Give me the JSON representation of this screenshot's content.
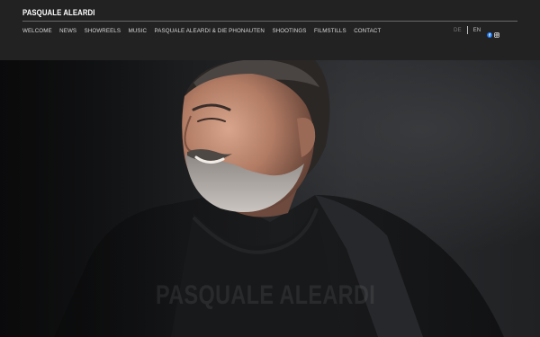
{
  "site": {
    "title": "PASQUALE ALEARDI"
  },
  "nav": {
    "items": [
      {
        "label": "WELCOME"
      },
      {
        "label": "NEWS"
      },
      {
        "label": "SHOWREELS"
      },
      {
        "label": "MUSIC"
      },
      {
        "label": "PASQUALE ALEARDI & DIE PHONAUTEN"
      },
      {
        "label": "SHOOTINGS"
      },
      {
        "label": "FILMSTILLS"
      },
      {
        "label": "CONTACT"
      }
    ]
  },
  "language": {
    "de": "DE",
    "en": "EN"
  },
  "social": {
    "icons": [
      "facebook-icon",
      "instagram-icon"
    ]
  },
  "hero": {
    "watermark": "PASQUALE ALEARDI"
  },
  "colors": {
    "header_bg": "#222222",
    "page_bg": "#141414",
    "facebook_blue": "#1877f2"
  }
}
